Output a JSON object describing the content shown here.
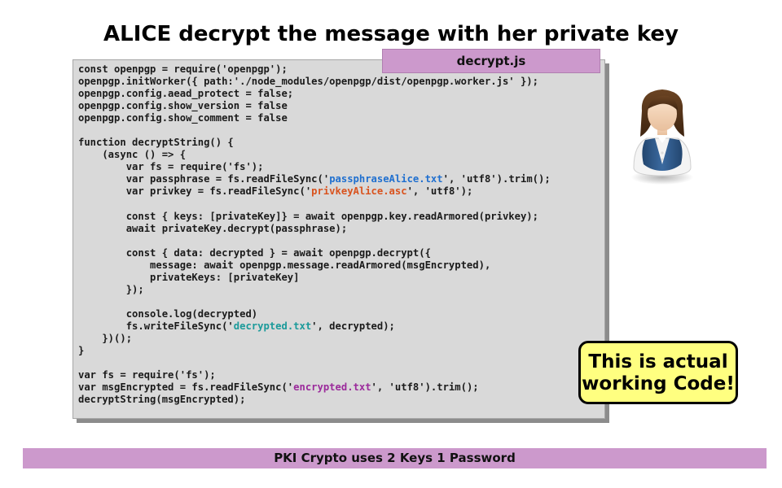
{
  "slide": {
    "title": "ALICE decrypt the message with her private key",
    "filename": "decrypt.js",
    "callout": {
      "line1": "This is actual",
      "line2": "working Code!"
    },
    "footer": "PKI Crypto uses 2 Keys 1 Password",
    "avatar_icon": "user-woman-icon"
  },
  "colors": {
    "accent_bar": "#cc99cc",
    "code_panel": "#d9d9d9",
    "callout_bg": "#ffff80",
    "passphrase_file": "#1f6fcf",
    "privkey_file": "#d9531e",
    "decrypted_file": "#1a9a9a",
    "encrypted_file": "#9b2a9b"
  },
  "code": {
    "lines": [
      "const openpgp = require('openpgp');",
      "openpgp.initWorker({ path:'./node_modules/openpgp/dist/openpgp.worker.js' });",
      "openpgp.config.aead_protect = false;",
      "openpgp.config.show_version = false",
      "openpgp.config.show_comment = false",
      "",
      "function decryptString() {",
      "    (async () => {",
      "        var fs = require('fs');",
      "        var passphrase = fs.readFileSync('passphraseAlice.txt', 'utf8').trim();",
      "        var privkey = fs.readFileSync('privkeyAlice.asc', 'utf8');",
      "",
      "        const { keys: [privateKey]} = await openpgp.key.readArmored(privkey);",
      "        await privateKey.decrypt(passphrase);",
      "",
      "        const { data: decrypted } = await openpgp.decrypt({",
      "            message: await openpgp.message.readArmored(msgEncrypted),",
      "            privateKeys: [privateKey]",
      "        });",
      "",
      "        console.log(decrypted)",
      "        fs.writeFileSync('decrypted.txt', decrypted);",
      "    })();",
      "}",
      "",
      "var fs = require('fs');",
      "var msgEncrypted = fs.readFileSync('encrypted.txt', 'utf8').trim();",
      "decryptString(msgEncrypted);"
    ],
    "highlights": [
      {
        "text": "passphraseAlice.txt",
        "color_class": "fn-blue"
      },
      {
        "text": "privkeyAlice.asc",
        "color_class": "fn-red"
      },
      {
        "text": "decrypted.txt",
        "color_class": "fn-teal"
      },
      {
        "text": "encrypted.txt",
        "color_class": "fn-purple"
      }
    ]
  }
}
